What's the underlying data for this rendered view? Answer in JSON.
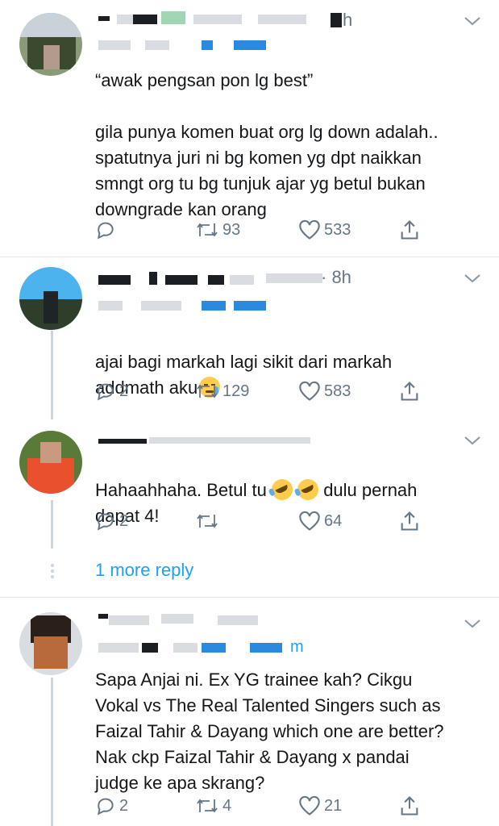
{
  "tweets": [
    {
      "time": "h",
      "text": "“awak pengsan pon lg best”\n\ngila punya komen buat org lg down adalah..\nspatutnya juri ni bg komen yg dpt naikkan\nsmngt org tu bg tunjuk ajar yg betul bukan\ndowngrade kan orang",
      "reply_count": "",
      "retweet_count": "93",
      "like_count": "533"
    },
    {
      "time": "· 8h",
      "text": "ajai bagi markah lagi sikit dari markah\naddmath aku",
      "reply_count": "2",
      "retweet_count": "129",
      "like_count": "583"
    },
    {
      "time": "",
      "text_before": "Hahaahhaha. Betul tu ",
      "text_after": " dulu pernah\ndapat 4!",
      "reply_count": "2",
      "retweet_count": "",
      "like_count": "64"
    },
    {
      "time": "m",
      "text": "Sapa Anjai ni. Ex YG trainee kah? Cikgu\nVokal vs The Real Talented Singers such as\nFaizal Tahir & Dayang which one are better?\nNak ckp Faizal Tahir & Dayang x pandai\njudge ke apa skrang?",
      "reply_count": "2",
      "retweet_count": "4",
      "like_count": "21"
    }
  ],
  "more_reply": "1 more reply",
  "colors": {
    "link": "#1da1f2",
    "muted": "#657786",
    "text": "#14171a",
    "divider": "#e1e8ed"
  },
  "icons": [
    "reply-icon",
    "retweet-icon",
    "like-icon",
    "share-icon",
    "chevron-down-icon",
    "more-dots-icon",
    "crying-face-emoji",
    "rofl-emoji"
  ]
}
